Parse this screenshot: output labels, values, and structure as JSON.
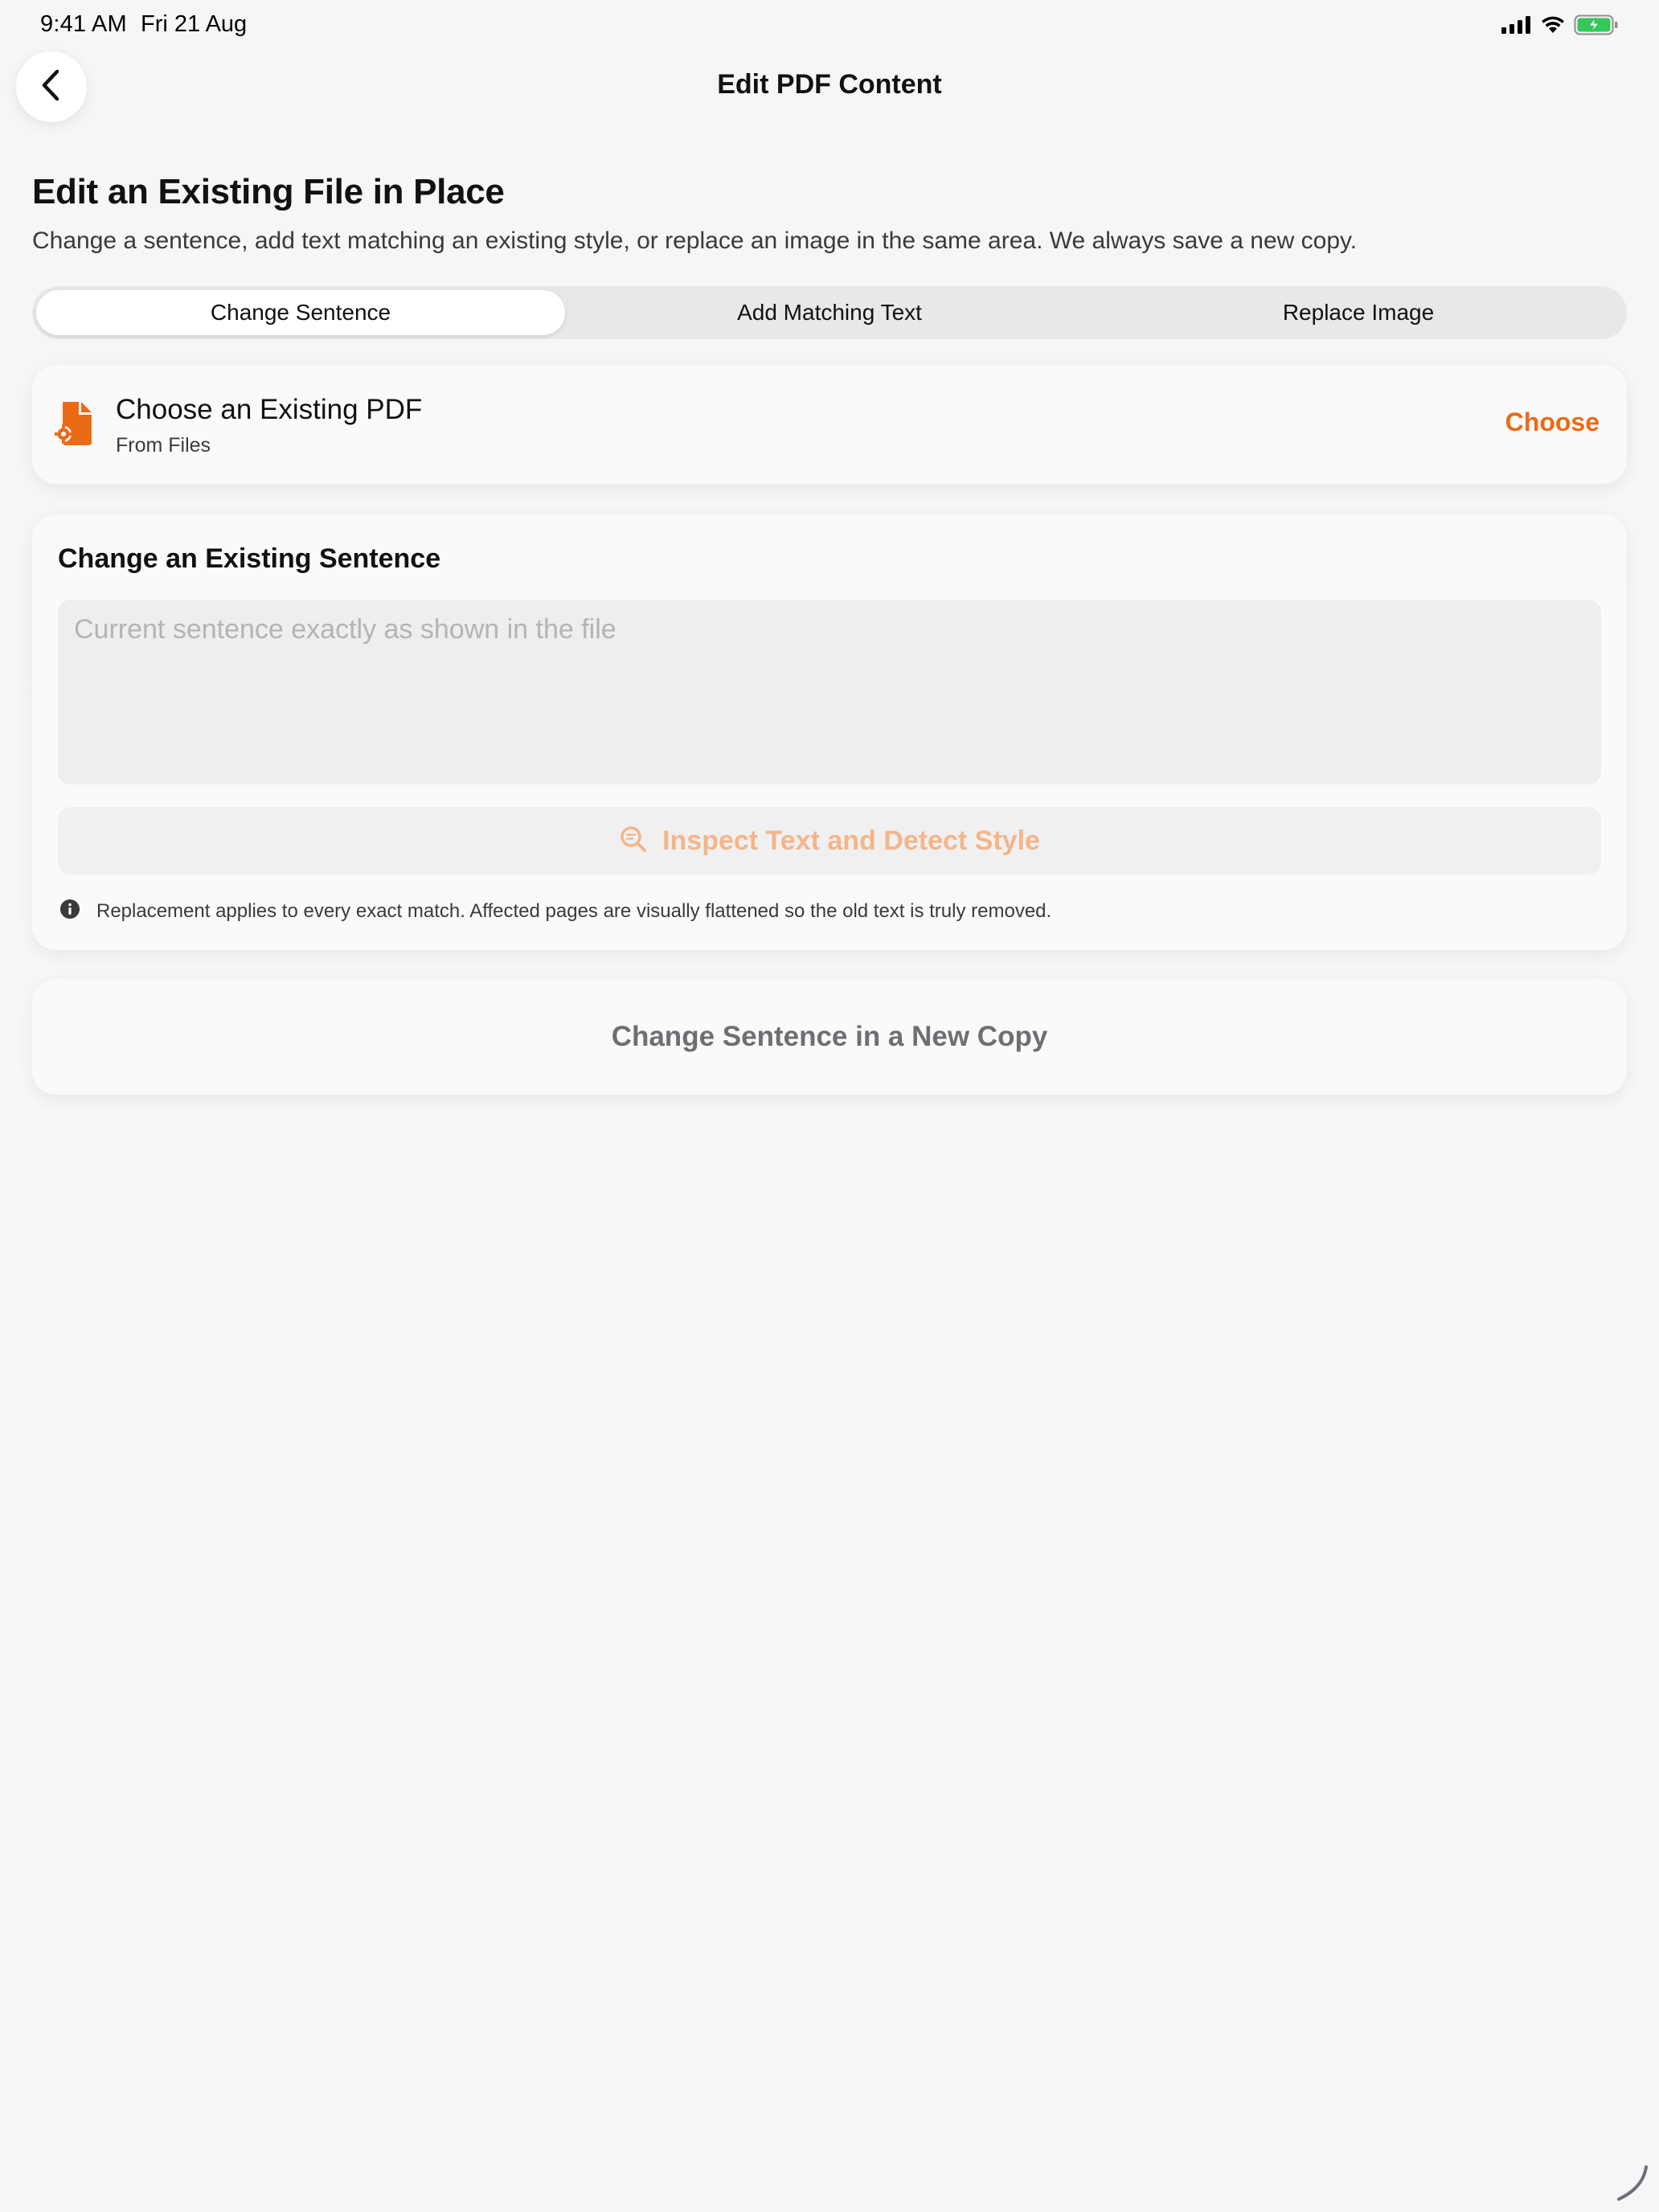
{
  "status_bar": {
    "time": "9:41 AM",
    "date": "Fri 21 Aug",
    "icons": [
      "cellular-signal-icon",
      "wifi-icon",
      "battery-charging-icon"
    ],
    "battery_color": "#34c759"
  },
  "nav": {
    "back_icon": "chevron-left-icon",
    "title": "Edit PDF Content"
  },
  "header": {
    "title": "Edit an Existing File in Place",
    "subtitle": "Change a sentence, add text matching an existing style, or replace an image in the same area. We always save a new copy."
  },
  "tabs": [
    {
      "label": "Change Sentence",
      "selected": true
    },
    {
      "label": "Add Matching Text",
      "selected": false
    },
    {
      "label": "Replace Image",
      "selected": false
    }
  ],
  "file_picker": {
    "icon": "document-gear-icon",
    "title": "Choose an Existing PDF",
    "subtitle": "From Files",
    "action_label": "Choose"
  },
  "edit_section": {
    "title": "Change an Existing Sentence",
    "input_placeholder": "Current sentence exactly as shown in the file",
    "input_value": "",
    "inspect_label": "Inspect Text and Detect Style",
    "inspect_icon": "magnifying-glass-text-icon",
    "info_icon": "info-circle-icon",
    "info_text": "Replacement applies to every exact match. Affected pages are visually flattened so the old text is truly removed."
  },
  "primary_action": {
    "label": "Change Sentence in a New Copy"
  },
  "colors": {
    "accent": "#ec6a16",
    "accent_disabled": "#f5b589",
    "background": "#f6f6f7",
    "card": "#fafafa"
  }
}
